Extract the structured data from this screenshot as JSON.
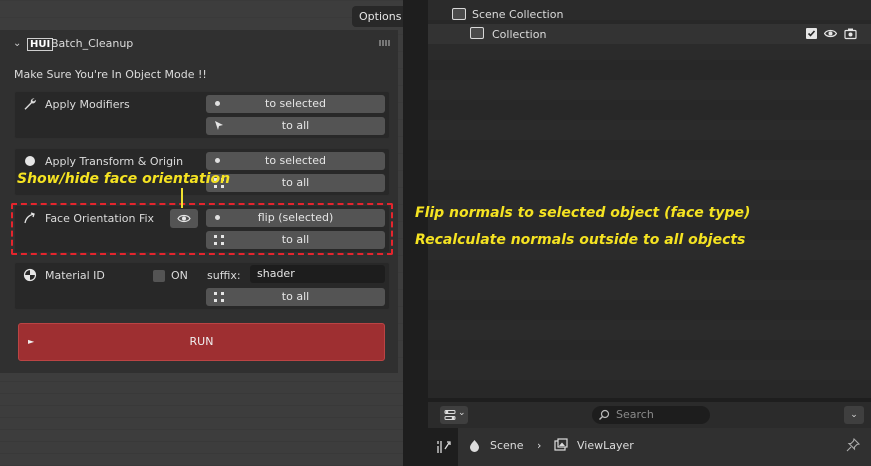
{
  "viewport": {
    "options_label": "Options"
  },
  "panel": {
    "title": "Batch_Cleanup",
    "logo_text": "HUI",
    "mode_note": "Make Sure You're In Object Mode !!",
    "apply_modifiers": {
      "label": "Apply Modifiers",
      "btn_selected": "to selected",
      "btn_all": "to all"
    },
    "apply_transform": {
      "label": "Apply Transform & Origin",
      "btn_selected": "to selected",
      "btn_all": "to all"
    },
    "face_orientation": {
      "label": "Face Orientation Fix",
      "btn_selected": "flip (selected)",
      "btn_all": "to all"
    },
    "material_id": {
      "label": "Material ID",
      "checkbox_label": "ON",
      "suffix_label": "suffix:",
      "suffix_value": "shader",
      "btn_all": "to all"
    },
    "run_label": "RUN"
  },
  "annotations": {
    "show_hide": "Show/hide face orientation",
    "flip_normals": "Flip normals to selected object (face type)",
    "recalc_normals": "Recalculate normals outside to all objects",
    "color": "#f5e322",
    "outline_color": "#e4252d"
  },
  "outliner": {
    "scene_collection": "Scene Collection",
    "collection": "Collection"
  },
  "properties": {
    "search_placeholder": "Search",
    "breadcrumb_scene": "Scene",
    "breadcrumb_viewlayer": "ViewLayer"
  },
  "colors": {
    "run_button": "#9e2f31",
    "button": "#545454",
    "panel_bg": "#303030"
  }
}
